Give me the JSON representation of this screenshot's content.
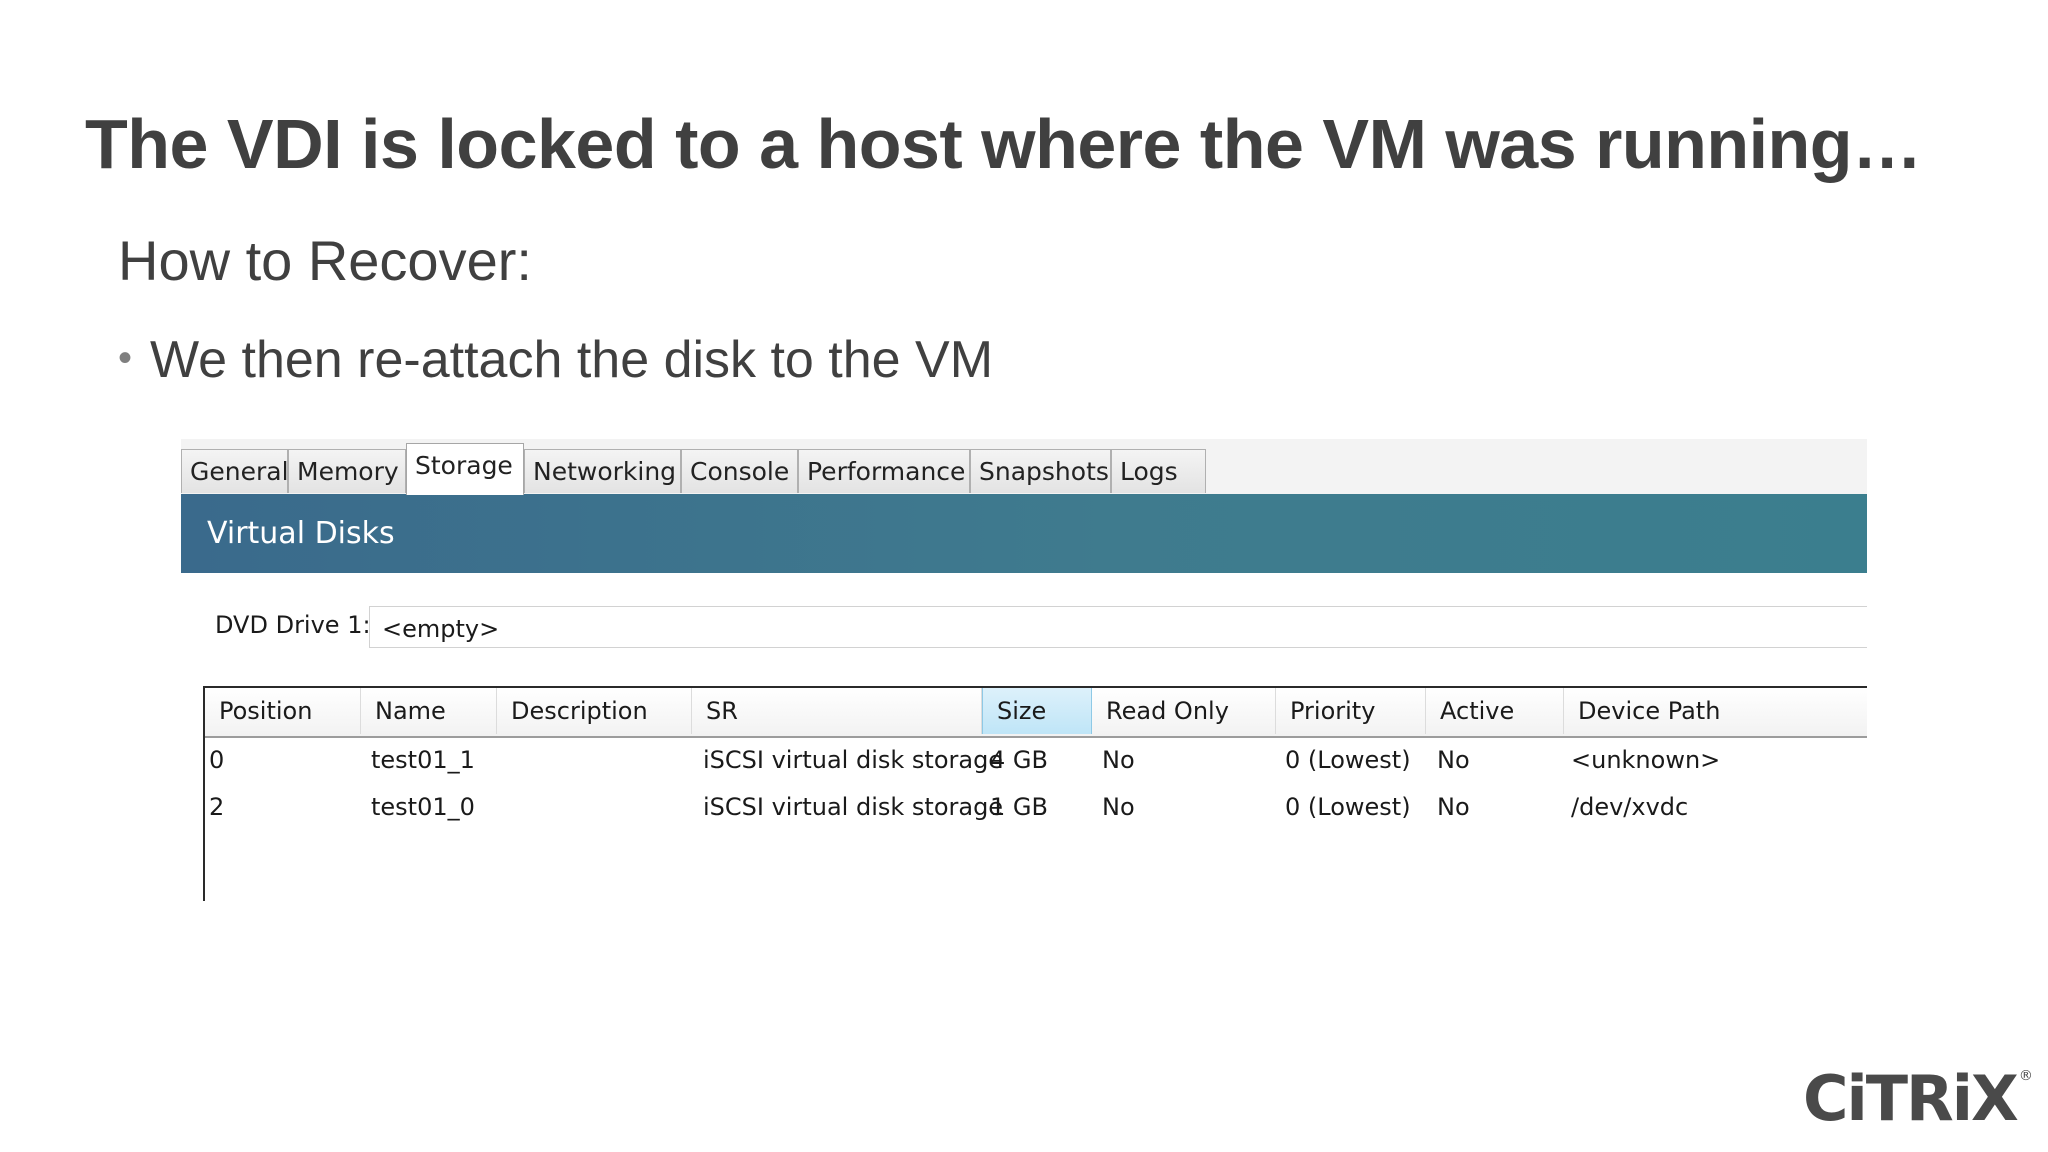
{
  "slide": {
    "title": "The VDI is locked to a host where the VM was running…",
    "subtitle": "How to Recover:",
    "bullet": "We then re-attach the disk to the VM",
    "bullet_marker": "•"
  },
  "app": {
    "tabs": [
      "General",
      "Memory",
      "Storage",
      "Networking",
      "Console",
      "Performance",
      "Snapshots",
      "Logs"
    ],
    "active_tab": "Storage",
    "section_title": "Virtual Disks",
    "header_color": "#3f7b8e",
    "dvd": {
      "label": "DVD Drive 1:",
      "value": "<empty>"
    },
    "table": {
      "columns": [
        "Position",
        "Name",
        "Description",
        "SR",
        "Size",
        "Read Only",
        "Priority",
        "Active",
        "Device Path"
      ],
      "sorted_column": "Size",
      "rows": [
        [
          "0",
          "test01_1",
          "",
          "iSCSI virtual disk storage",
          "4 GB",
          "No",
          "0 (Lowest)",
          "No",
          "<unknown>"
        ],
        [
          "2",
          "test01_0",
          "",
          "iSCSI virtual disk storage",
          "1 GB",
          "No",
          "0 (Lowest)",
          "No",
          "/dev/xvdc"
        ]
      ]
    }
  },
  "logo": {
    "text": "CiTRiX",
    "mark": "®"
  }
}
